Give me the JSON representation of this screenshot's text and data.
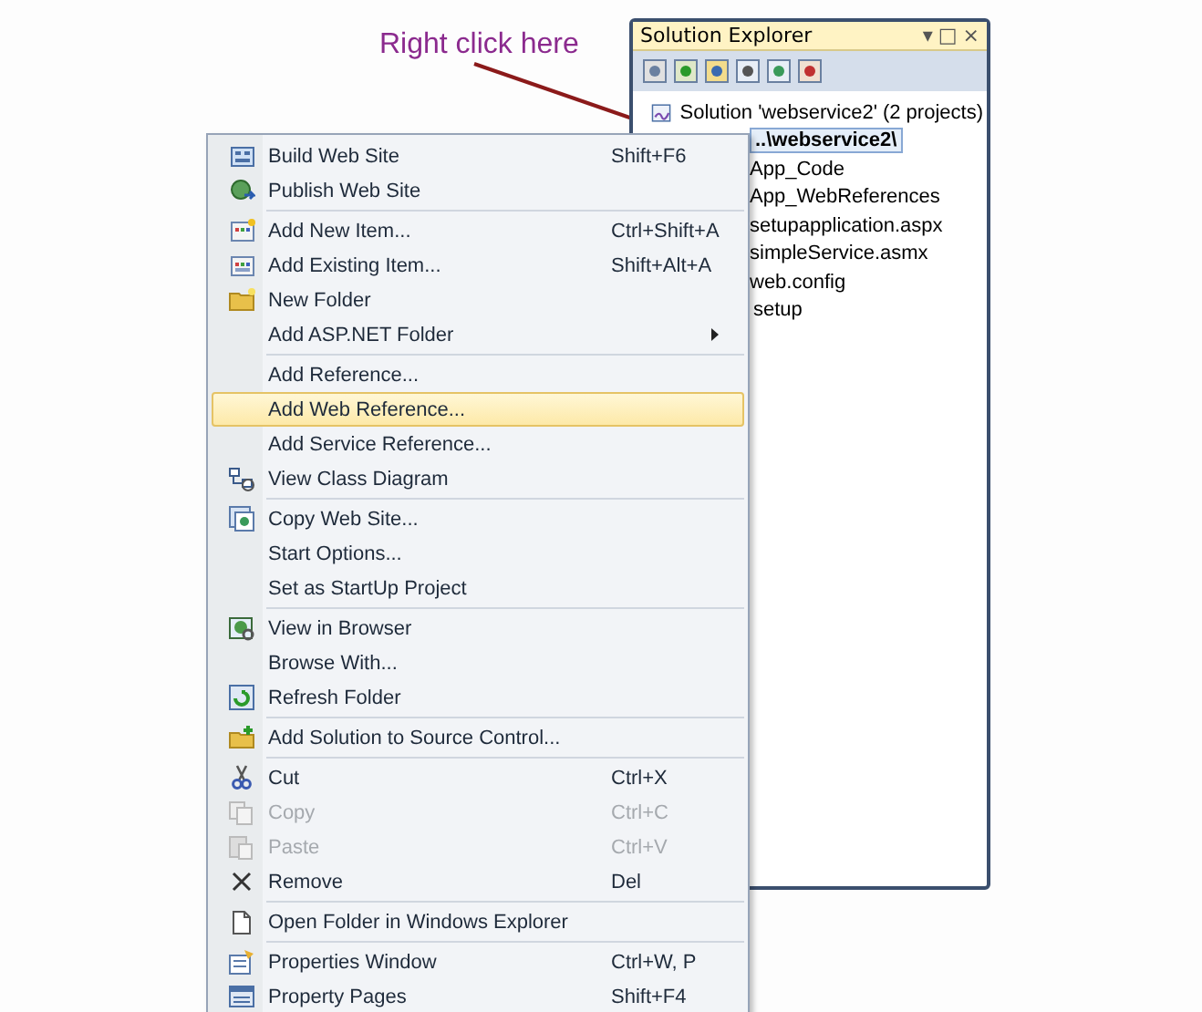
{
  "annotation": {
    "text": "Right click here"
  },
  "solution_explorer": {
    "title": "Solution Explorer",
    "title_buttons": [
      "▾",
      "□",
      "×"
    ],
    "tree": [
      {
        "label": "Solution 'webservice2' (2 projects)",
        "selected": false,
        "children": [
          {
            "label": "..\\webservice2\\",
            "selected": true,
            "children": [
              {
                "label": "App_Code",
                "selected": false
              },
              {
                "label": "App_WebReferences",
                "selected": false
              },
              {
                "label": "setupapplication.aspx",
                "selected": false
              },
              {
                "label": "simpleService.asmx",
                "selected": false
              },
              {
                "label": "web.config",
                "selected": false
              }
            ]
          },
          {
            "label": "setup",
            "selected": false
          }
        ]
      }
    ]
  },
  "context_menu": {
    "groups": [
      [
        {
          "label": "Build Web Site",
          "shortcut": "Shift+F6",
          "selected": false,
          "disabled": false
        },
        {
          "label": "Publish Web Site",
          "selected": false,
          "disabled": false
        }
      ],
      [
        {
          "label": "Add New Item...",
          "shortcut": "Ctrl+Shift+A",
          "selected": false,
          "disabled": false
        },
        {
          "label": "Add Existing Item...",
          "shortcut": "Shift+Alt+A",
          "selected": false,
          "disabled": false
        },
        {
          "label": "New Folder",
          "selected": false,
          "disabled": false
        },
        {
          "label": "Add ASP.NET Folder",
          "submenu": true,
          "selected": false,
          "disabled": false
        }
      ],
      [
        {
          "label": "Add Reference...",
          "selected": false,
          "disabled": false
        },
        {
          "label": "Add Web Reference...",
          "selected": true,
          "disabled": false
        },
        {
          "label": "Add Service Reference...",
          "selected": false,
          "disabled": false
        },
        {
          "label": "View Class Diagram",
          "selected": false,
          "disabled": false
        }
      ],
      [
        {
          "label": "Copy Web Site...",
          "selected": false,
          "disabled": false
        },
        {
          "label": "Start Options...",
          "selected": false,
          "disabled": false
        },
        {
          "label": "Set as StartUp Project",
          "selected": false,
          "disabled": false
        }
      ],
      [
        {
          "label": "View in Browser",
          "selected": false,
          "disabled": false
        },
        {
          "label": "Browse With...",
          "selected": false,
          "disabled": false
        },
        {
          "label": "Refresh Folder",
          "selected": false,
          "disabled": false
        }
      ],
      [
        {
          "label": "Add Solution to Source Control...",
          "selected": false,
          "disabled": false
        }
      ],
      [
        {
          "label": "Cut",
          "shortcut": "Ctrl+X",
          "selected": false,
          "disabled": false
        },
        {
          "label": "Copy",
          "shortcut": "Ctrl+C",
          "selected": false,
          "disabled": true
        },
        {
          "label": "Paste",
          "shortcut": "Ctrl+V",
          "selected": false,
          "disabled": true
        },
        {
          "label": "Remove",
          "shortcut": "Del",
          "selected": false,
          "disabled": false
        }
      ],
      [
        {
          "label": "Open Folder in Windows Explorer",
          "selected": false,
          "disabled": false
        }
      ],
      [
        {
          "label": "Properties Window",
          "shortcut": "Ctrl+W, P",
          "selected": false,
          "disabled": false
        },
        {
          "label": "Property Pages",
          "shortcut": "Shift+F4",
          "selected": false,
          "disabled": false
        }
      ]
    ]
  }
}
